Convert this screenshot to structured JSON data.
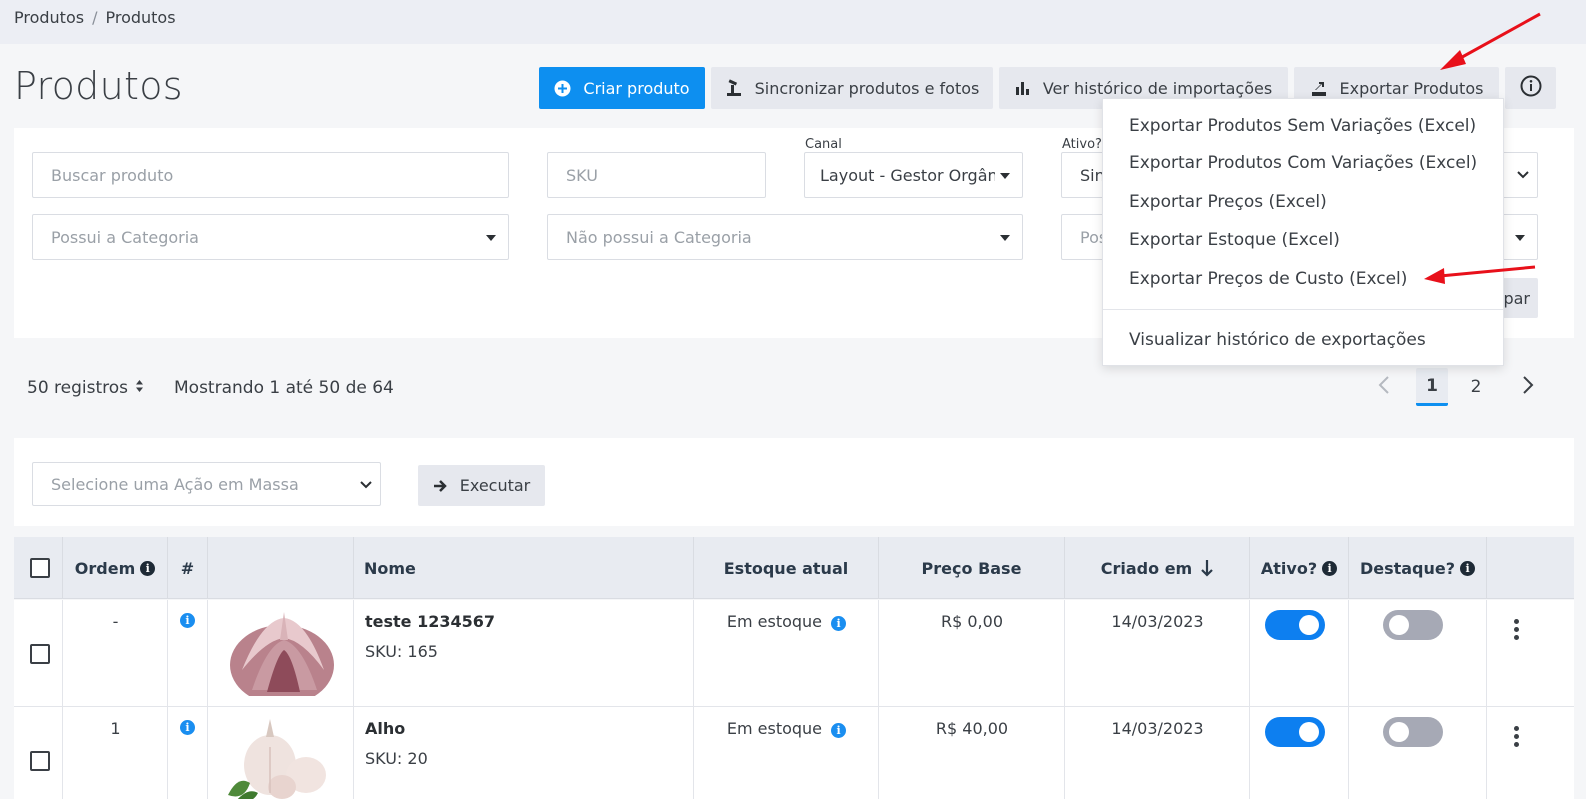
{
  "breadcrumb": {
    "items": [
      "Produtos",
      "Produtos"
    ],
    "separator": "/"
  },
  "page_title": "Produtos",
  "header_buttons": {
    "create": "Criar produto",
    "sync": "Sincronizar produtos e fotos",
    "history": "Ver histórico de importações",
    "export": "Exportar Produtos"
  },
  "filters": {
    "search_placeholder": "Buscar produto",
    "sku_placeholder": "SKU",
    "canal_label": "Canal",
    "canal_value": "Layout - Gestor Orgân",
    "ativo_label": "Ativo?",
    "ativo_value": "Sin",
    "has_category_placeholder": "Possui a Categoria",
    "not_category_placeholder": "Não possui a Categoria",
    "pos_partial": "Pos",
    "clear_partial": "par"
  },
  "export_menu": {
    "items": [
      "Exportar Produtos Sem Variações (Excel)",
      "Exportar Produtos Com Variações (Excel)",
      "Exportar Preços (Excel)",
      "Exportar Estoque (Excel)",
      "Exportar Preços de Custo (Excel)"
    ],
    "footer": "Visualizar histórico de exportações"
  },
  "toolbar": {
    "per_page": "50 registros",
    "showing": "Mostrando 1 até 50 de 64",
    "pages": [
      "1",
      "2"
    ],
    "current_page": "1"
  },
  "mass_action": {
    "placeholder": "Selecione uma Ação em Massa",
    "execute": "Executar"
  },
  "table": {
    "headers": {
      "ordem": "Ordem",
      "hash": "#",
      "nome": "Nome",
      "estoque": "Estoque atual",
      "preco": "Preço Base",
      "criado": "Criado em",
      "ativo": "Ativo?",
      "destaque": "Destaque?"
    },
    "rows": [
      {
        "ordem": "-",
        "name": "teste 1234567",
        "sku": "SKU: 165",
        "stock": "Em estoque",
        "price": "R$ 0,00",
        "created": "14/03/2023",
        "active": true,
        "featured": false
      },
      {
        "ordem": "1",
        "name": "Alho",
        "sku": "SKU: 20",
        "stock": "Em estoque",
        "price": "R$ 40,00",
        "created": "14/03/2023",
        "active": true,
        "featured": false
      }
    ]
  },
  "colors": {
    "primary": "#0d8ff0",
    "toggle_on": "#0d7ff0",
    "toggle_off": "#a6a9b5",
    "annotation_arrow": "#e8101a"
  }
}
